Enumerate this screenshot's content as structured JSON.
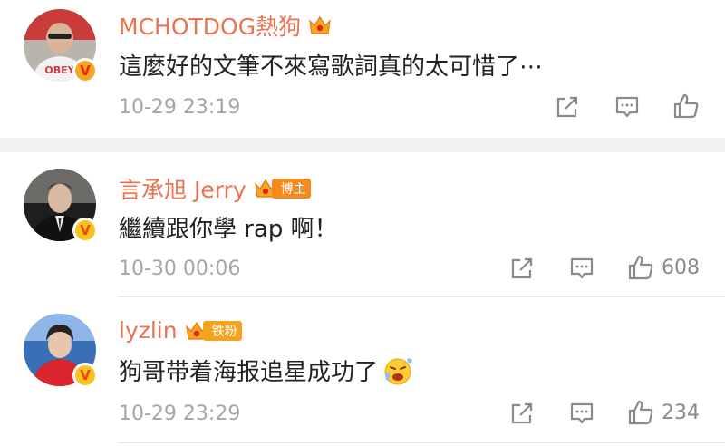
{
  "comments": [
    {
      "username": "MCHOTDOG熱狗",
      "text": "這麼好的文筆不來寫歌詞真的太可惜了⋯",
      "time": "10-29 23:19",
      "likes": ""
    },
    {
      "username": "言承旭 Jerry",
      "badge": "博主",
      "text": "繼續跟你學 rap 啊！",
      "time": "10-30 00:06",
      "likes": "608"
    },
    {
      "username": "lyzlin",
      "badge": "铁粉",
      "text": "狗哥带着海报追星成功了",
      "time": "10-29 23:29",
      "likes": "234"
    }
  ],
  "colors": {
    "username": "#eb7350",
    "text": "#222222",
    "meta": "#a6a6a6",
    "badge_orange": "#f5891e",
    "verified_gold": "#f7c31f"
  },
  "icons": [
    "share-icon",
    "comment-icon",
    "like-icon",
    "crown-icon",
    "verified-icon",
    "emoji-icon"
  ]
}
